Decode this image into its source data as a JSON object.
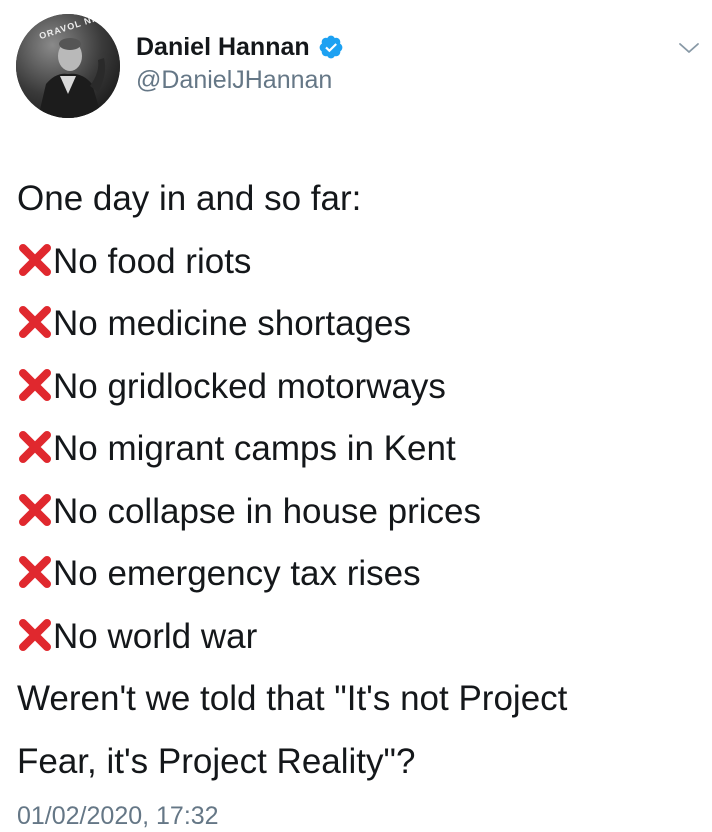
{
  "author": {
    "name": "Daniel Hannan",
    "handle": "@DanielJHannan",
    "avatar_badge_text": "ORAVOL NF"
  },
  "tweet": {
    "intro": "One day in and so far:",
    "items": [
      "No food riots",
      "No medicine shortages",
      "No gridlocked motorways",
      "No migrant camps in Kent",
      "No collapse in house prices",
      "No emergency tax rises",
      "No world war"
    ],
    "closing_line_1": "Weren't we told that \"It's not Project",
    "closing_line_2": "Fear, it's Project Reality\"?"
  },
  "timestamp": "01/02/2020, 17:32",
  "icons": {
    "verified": "verified-badge-icon",
    "menu": "chevron-down-icon",
    "bullet": "cross-mark-icon"
  },
  "colors": {
    "verified_blue": "#1da1f2",
    "cross_red": "#e0282e",
    "secondary_text": "#657786"
  }
}
